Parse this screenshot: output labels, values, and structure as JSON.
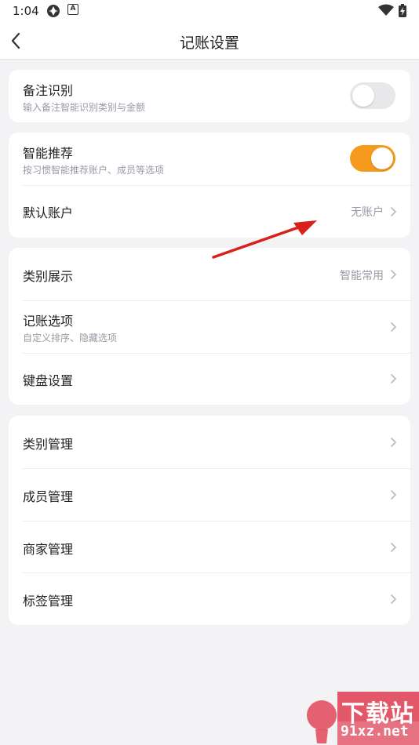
{
  "status_bar": {
    "time": "1:04",
    "icons": [
      "location-share-icon",
      "app-badge-icon",
      "wifi-icon",
      "battery-charging-icon"
    ],
    "app_badge_letter": "A"
  },
  "header": {
    "title": "记账设置",
    "back_icon": "chevron-left-icon"
  },
  "card1": {
    "remark_recognition": {
      "label": "备注识别",
      "subtitle": "输入备注智能识别类别与金额",
      "toggle_on": false
    }
  },
  "card2": {
    "smart_recommend": {
      "label": "智能推荐",
      "subtitle": "按习惯智能推荐账户、成员等选项",
      "toggle_on": true
    },
    "default_account": {
      "label": "默认账户",
      "value": "无账户"
    }
  },
  "card3": {
    "category_display": {
      "label": "类别展示",
      "value": "智能常用"
    },
    "bookkeeping_options": {
      "label": "记账选项",
      "subtitle": "自定义排序、隐藏选项"
    },
    "keyboard_settings": {
      "label": "键盘设置"
    }
  },
  "card4": {
    "items": [
      {
        "label": "类别管理"
      },
      {
        "label": "成员管理"
      },
      {
        "label": "商家管理"
      },
      {
        "label": "标签管理"
      }
    ]
  },
  "watermark": {
    "title": "下载站",
    "url": "91xz.net"
  },
  "colors": {
    "toggle_on": "#f59a1c",
    "toggle_off": "#e8e8ea",
    "annotation_arrow": "#d9201a",
    "watermark": "#e1475a"
  }
}
